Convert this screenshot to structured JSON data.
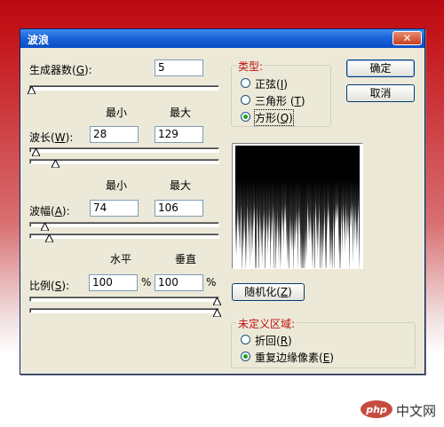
{
  "window": {
    "title": "波浪",
    "close_icon": "close-icon"
  },
  "generators": {
    "label": "生成器数(",
    "hotkey": "G",
    "label_end": "):",
    "value": "5",
    "slider_fraction": 0.0
  },
  "headers": {
    "min": "最小",
    "max": "最大",
    "horizontal": "水平",
    "vertical": "垂直"
  },
  "wavelength": {
    "label": "波长(",
    "hotkey": "W",
    "label_end": "):",
    "min": "28",
    "max": "129",
    "min_slider_fraction": 0.03,
    "max_slider_fraction": 0.13
  },
  "amplitude": {
    "label": "波幅(",
    "hotkey": "A",
    "label_end": "):",
    "min": "74",
    "max": "106",
    "min_slider_fraction": 0.08,
    "max_slider_fraction": 0.1
  },
  "scale": {
    "label": "比例(",
    "hotkey": "S",
    "label_end": "):",
    "horizontal": "100",
    "vertical": "100",
    "unit": "%",
    "h_slider_fraction": 1.0,
    "v_slider_fraction": 1.0
  },
  "type_group": {
    "title": "类型:",
    "options": [
      {
        "label": "正弦(",
        "hotkey": "I",
        "end": ")",
        "selected": false
      },
      {
        "label": "三角形 (",
        "hotkey": "T",
        "end": ")",
        "selected": false
      },
      {
        "label": "方形(",
        "hotkey": "Q",
        "end": ")",
        "selected": true
      }
    ]
  },
  "buttons": {
    "ok": "确定",
    "cancel": "取消",
    "randomize_label": "随机化(",
    "randomize_hotkey": "Z",
    "randomize_end": ")"
  },
  "undefined_group": {
    "title": "未定义区域:",
    "options": [
      {
        "label": "折回(",
        "hotkey": "R",
        "end": ")",
        "selected": false
      },
      {
        "label": "重复边缘像素(",
        "hotkey": "E",
        "end": ")",
        "selected": true
      }
    ]
  },
  "watermark": {
    "text": "中文网",
    "logo": "php"
  },
  "colors": {
    "title_bar": "#0a4ec6",
    "dialog_bg": "#ece9d8",
    "group_title": "#c01010",
    "radio_dot": "#21a121"
  }
}
